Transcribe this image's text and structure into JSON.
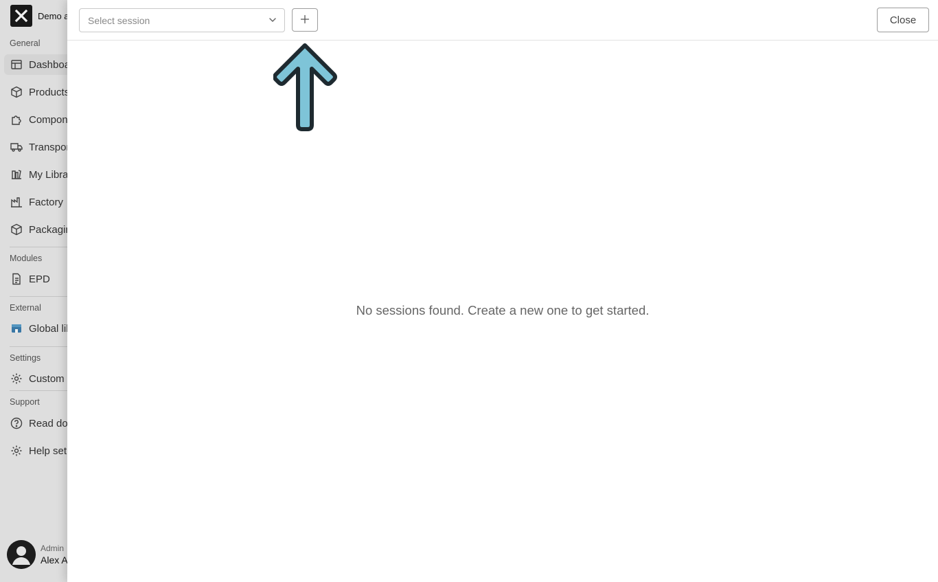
{
  "brand": {
    "name": "Demo a"
  },
  "sidebar": {
    "sections": [
      {
        "label": "General"
      },
      {
        "label": "Modules"
      },
      {
        "label": "External"
      },
      {
        "label": "Settings"
      },
      {
        "label": "Support"
      }
    ],
    "items": [
      {
        "label": "Dashboa",
        "icon": "dashboard-icon"
      },
      {
        "label": "Products",
        "icon": "box-icon"
      },
      {
        "label": "Compon",
        "icon": "puzzle-icon"
      },
      {
        "label": "Transpor",
        "icon": "truck-icon"
      },
      {
        "label": "My Libra",
        "icon": "library-icon"
      },
      {
        "label": "Factory",
        "icon": "factory-icon"
      },
      {
        "label": "Packagin",
        "icon": "package-icon"
      },
      {
        "label": "EPD",
        "icon": "document-icon"
      },
      {
        "label": "Global lib",
        "icon": "store-icon"
      },
      {
        "label": "Custom f",
        "icon": "gear-icon"
      },
      {
        "label": "Read doc",
        "icon": "help-circle-icon"
      },
      {
        "label": "Help set",
        "icon": "gear-icon"
      }
    ]
  },
  "user": {
    "role": "Admin",
    "name": "Alex A"
  },
  "toolbar": {
    "select_placeholder": "Select session",
    "add_icon": "plus-icon",
    "close_label": "Close"
  },
  "main": {
    "empty_message": "No sessions found. Create a new one to get started."
  },
  "colors": {
    "arrow_fill": "#7ec4d8",
    "arrow_stroke": "#1e2a30"
  }
}
